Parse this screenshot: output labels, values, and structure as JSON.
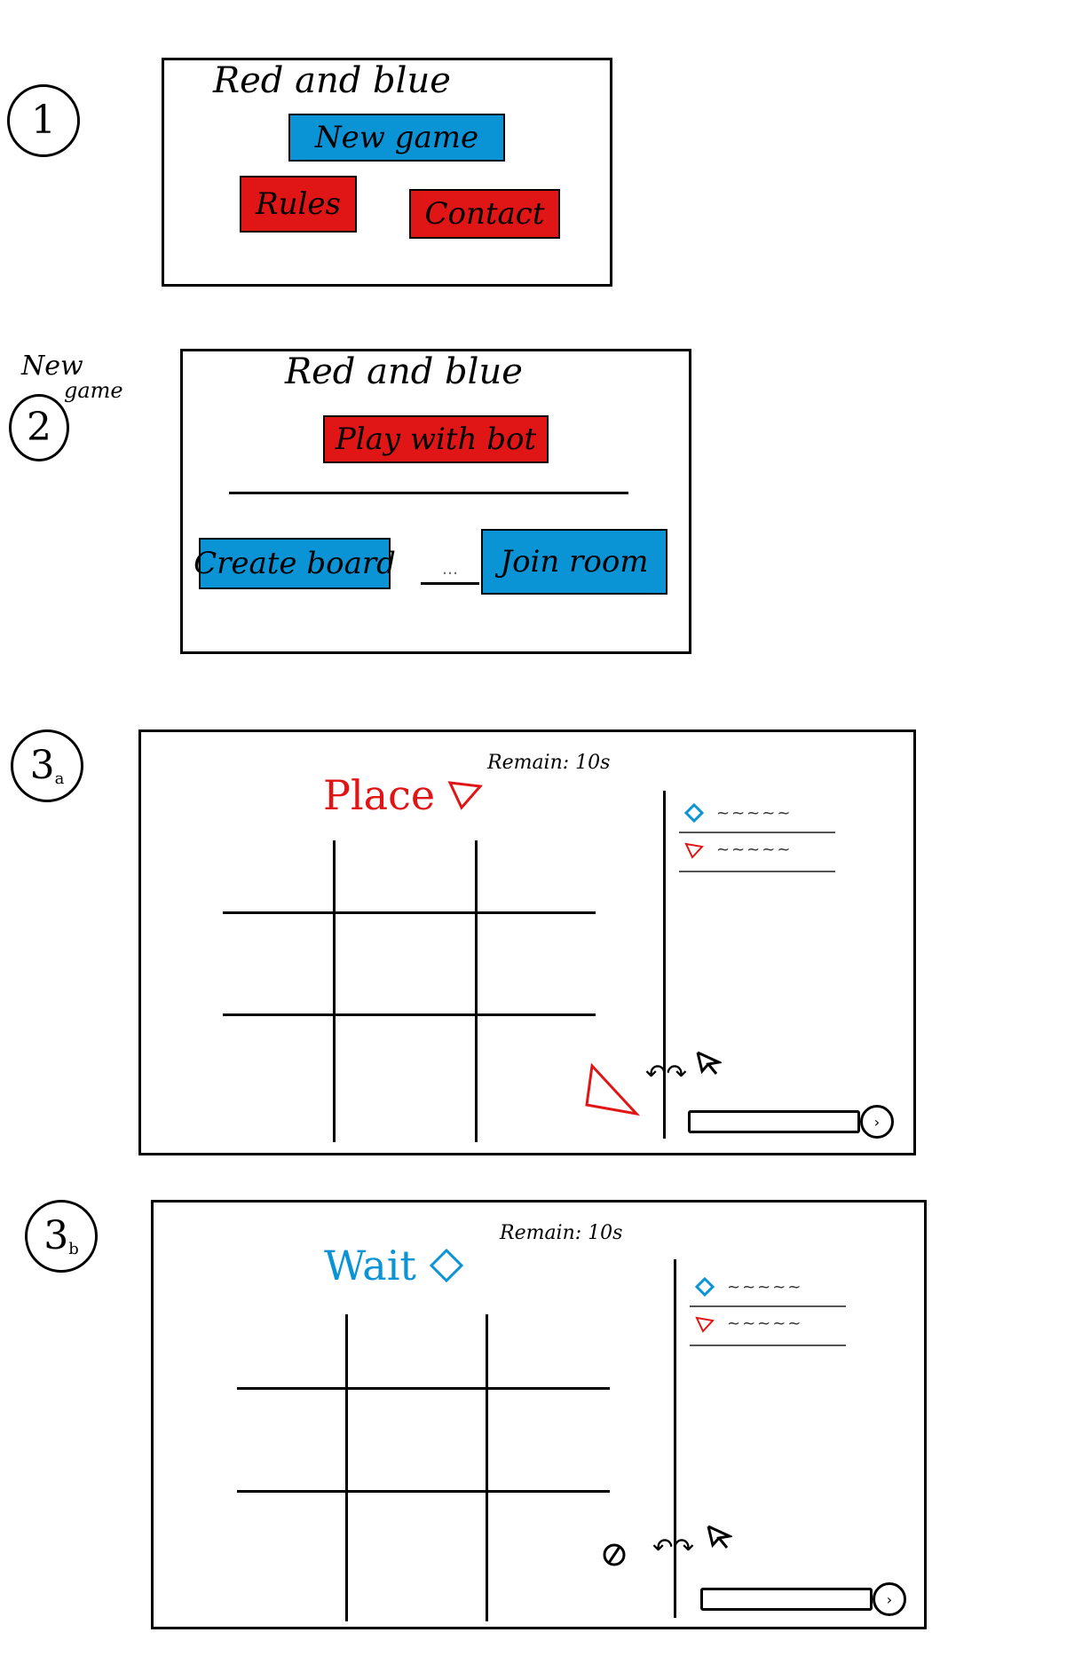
{
  "colors": {
    "blue": "#0a94d6",
    "red": "#e01515"
  },
  "steps": {
    "s1": {
      "marker": "1"
    },
    "s2": {
      "marker": "2",
      "note_line1": "New",
      "note_line2": "game"
    },
    "s3a": {
      "marker": "3",
      "sub": "a"
    },
    "s3b": {
      "marker": "3",
      "sub": "b"
    }
  },
  "screen1": {
    "title": "Red and blue",
    "new_game_label": "New game",
    "rules_label": "Rules",
    "contact_label": "Contact"
  },
  "screen2": {
    "title": "Red and blue",
    "play_with_bot_label": "Play with bot",
    "create_board_label": "Create board",
    "room_code_placeholder": "...",
    "join_room_label": "Join room"
  },
  "screen3a": {
    "timer": "Remain: 10s",
    "turn_label": "Place",
    "turn_icon": "triangle-icon",
    "chat_messages": [
      {
        "icon": "diamond-icon",
        "text": "~~~~~"
      },
      {
        "icon": "triangle-icon",
        "text": "~~~~~"
      }
    ],
    "swap_label": "↶↷",
    "cursor_icon": "cursor-icon",
    "send_label": "›"
  },
  "screen3b": {
    "timer": "Remain: 10s",
    "turn_label": "Wait",
    "turn_icon": "diamond-icon",
    "chat_messages": [
      {
        "icon": "diamond-icon",
        "text": "~~~~~"
      },
      {
        "icon": "triangle-icon",
        "text": "~~~~~"
      }
    ],
    "swap_label": "↶↷",
    "cursor_icon": "cursor-icon",
    "send_label": "›"
  }
}
